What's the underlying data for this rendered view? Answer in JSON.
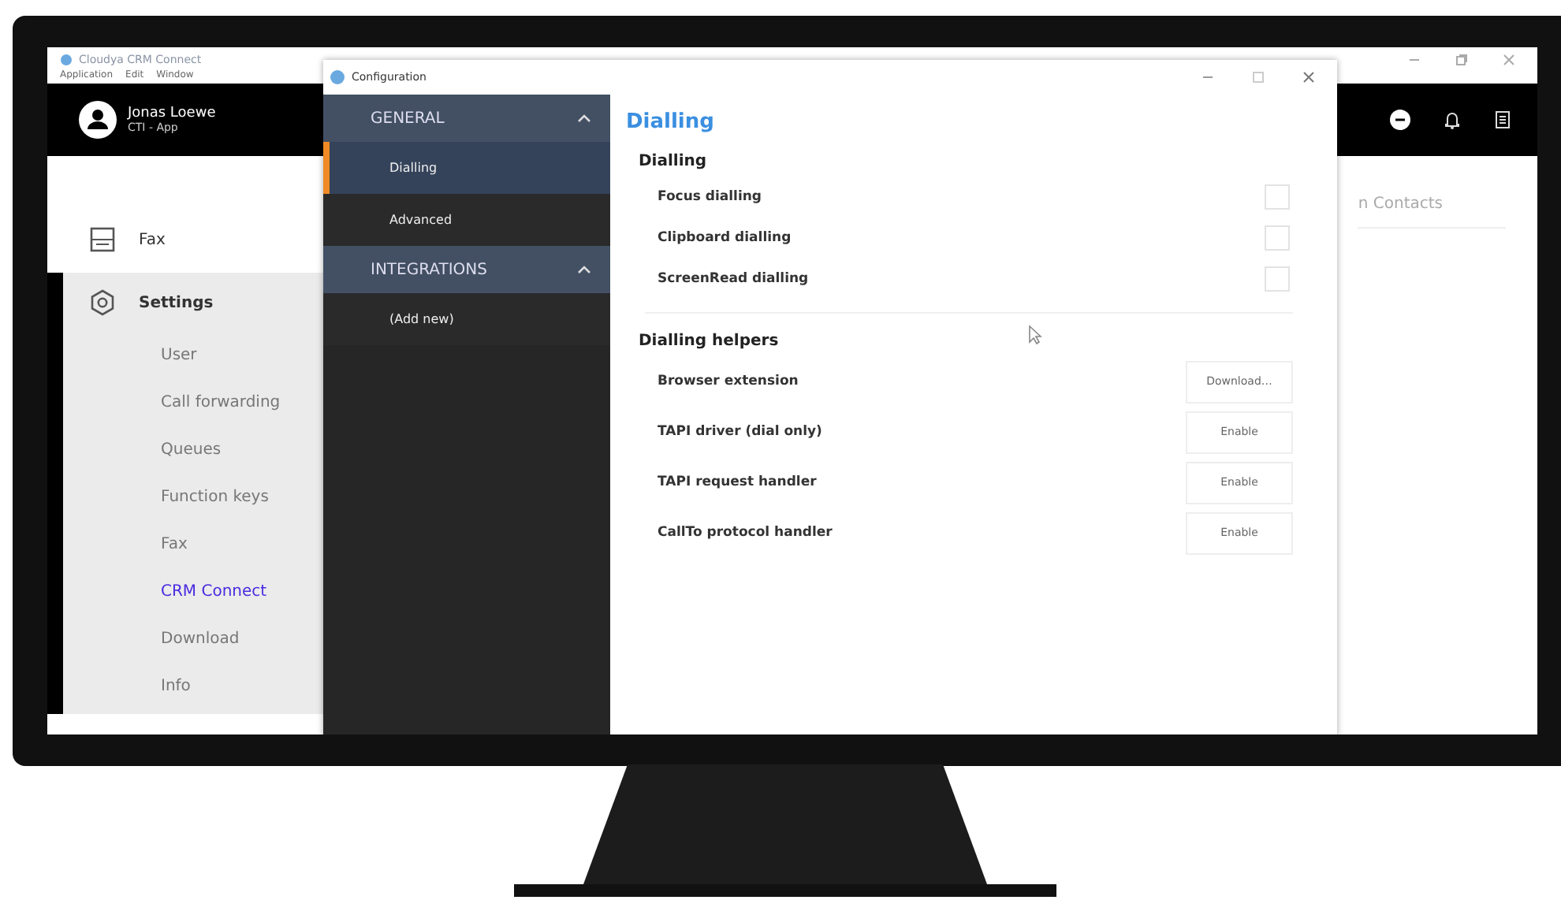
{
  "app_window": {
    "title": "Cloudya CRM Connect",
    "menu": [
      "Application",
      "Edit",
      "Window"
    ],
    "user": {
      "name": "Jonas Loewe",
      "subtitle": "CTI - App"
    },
    "nav": [
      {
        "label": "Fax",
        "selected": false
      },
      {
        "label": "Settings",
        "selected": true,
        "children": [
          {
            "label": "User",
            "selected": false
          },
          {
            "label": "Call forwarding",
            "selected": false
          },
          {
            "label": "Queues",
            "selected": false
          },
          {
            "label": "Function keys",
            "selected": false
          },
          {
            "label": "Fax",
            "selected": false
          },
          {
            "label": "CRM Connect",
            "selected": true
          },
          {
            "label": "Download",
            "selected": false
          },
          {
            "label": "Info",
            "selected": false
          }
        ]
      }
    ],
    "contacts_tab": "n Contacts"
  },
  "config_window": {
    "title": "Configuration",
    "sections": [
      {
        "label": "GENERAL",
        "expanded": true,
        "items": [
          {
            "label": "Dialling",
            "selected": true
          },
          {
            "label": "Advanced",
            "selected": false
          }
        ]
      },
      {
        "label": "INTEGRATIONS",
        "expanded": true,
        "items": [
          {
            "label": "(Add new)",
            "selected": false
          }
        ]
      }
    ],
    "page_title": "Dialling",
    "groups": [
      {
        "title": "Dialling",
        "rows": [
          {
            "kind": "checkbox",
            "label": "Focus dialling",
            "checked": false
          },
          {
            "kind": "checkbox",
            "label": "Clipboard dialling",
            "checked": false
          },
          {
            "kind": "checkbox",
            "label": "ScreenRead dialling",
            "checked": false
          }
        ]
      },
      {
        "title": "Dialling helpers",
        "rows": [
          {
            "kind": "button",
            "label": "Browser extension",
            "button": "Download…"
          },
          {
            "kind": "button",
            "label": "TAPI driver (dial only)",
            "button": "Enable"
          },
          {
            "kind": "button",
            "label": "TAPI request handler",
            "button": "Enable"
          },
          {
            "kind": "button",
            "label": "CallTo protocol handler",
            "button": "Enable"
          }
        ]
      }
    ]
  }
}
